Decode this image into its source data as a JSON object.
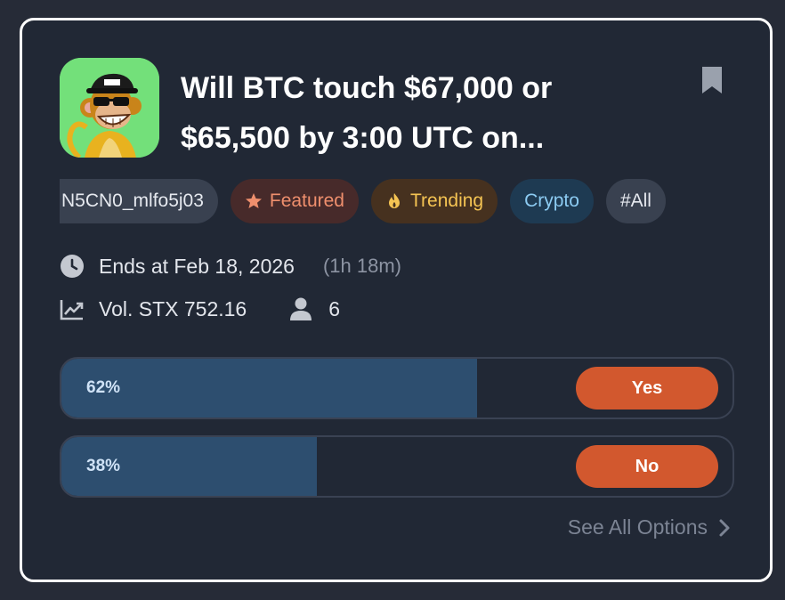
{
  "market": {
    "title_line1": "Will BTC touch $67,000 or",
    "title_line2": "$65,500 by 3:00 UTC on...",
    "tags": {
      "code": "N5CN0_mlfo5j03",
      "featured": "Featured",
      "trending": "Trending",
      "crypto": "Crypto",
      "all": "#All"
    },
    "ends_at": "Ends at Feb 18, 2026",
    "time_left": "(1h 18m)",
    "volume": "Vol. STX 752.16",
    "participants": "6",
    "options": [
      {
        "percent_label": "62%",
        "percent": 0.62,
        "button_label": "Yes"
      },
      {
        "percent_label": "38%",
        "percent": 0.38,
        "button_label": "No"
      }
    ],
    "see_all_label": "See All Options"
  },
  "icons": {
    "bookmark": "bookmark-icon",
    "star": "star-icon",
    "flame": "flame-icon",
    "clock": "clock-icon",
    "chart": "trend-chart-icon",
    "user": "user-icon",
    "chevron": "chevron-right-icon"
  },
  "colors": {
    "card_bg": "#212835",
    "accent_button": "#d2582e",
    "progress_fill": "#2d4e6f",
    "featured_text": "#ef8f6d",
    "trending_text": "#f5c453",
    "crypto_text": "#8ccbf2"
  }
}
